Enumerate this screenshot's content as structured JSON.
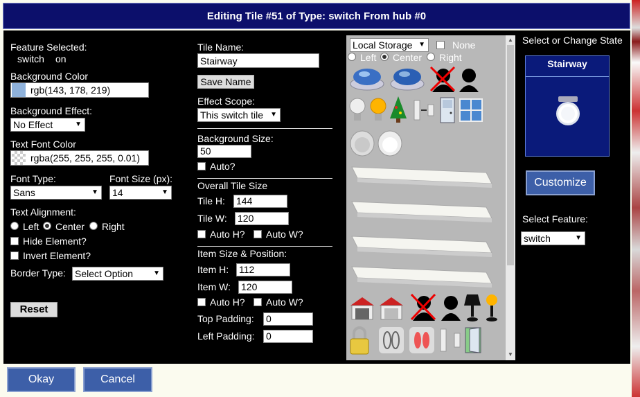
{
  "title": "Editing Tile #51 of Type: switch From hub #0",
  "left": {
    "feature_label": "Feature Selected:",
    "feature_name": "switch",
    "feature_state": "on",
    "bg_color_label": "Background Color",
    "bg_color_value": "rgb(143, 178, 219)",
    "bg_color_swatch": "#8fb2db",
    "bg_effect_label": "Background Effect:",
    "bg_effect_value": "No Effect",
    "text_color_label": "Text Font Color",
    "text_color_value": "rgba(255, 255, 255, 0.01)",
    "font_type_label": "Font Type:",
    "font_type_value": "Sans",
    "font_size_label": "Font Size (px):",
    "font_size_value": "14",
    "align_label": "Text Alignment:",
    "align_left": "Left",
    "align_center": "Center",
    "align_right": "Right",
    "hide_label": "Hide Element?",
    "invert_label": "Invert Element?",
    "border_label": "Border Type:",
    "border_value": "Select Option",
    "reset_label": "Reset"
  },
  "middle": {
    "tile_name_label": "Tile Name:",
    "tile_name_value": "Stairway",
    "save_name_label": "Save Name",
    "effect_scope_label": "Effect Scope:",
    "effect_scope_value": "This switch tile",
    "bg_size_label": "Background Size:",
    "bg_size_value": "50",
    "auto_label": "Auto?",
    "overall_label": "Overall Tile Size",
    "tile_h_label": "Tile H:",
    "tile_h_value": "144",
    "tile_w_label": "Tile W:",
    "tile_w_value": "120",
    "auto_h_label": "Auto H?",
    "auto_w_label": "Auto W?",
    "item_label": "Item Size & Position:",
    "item_h_label": "Item H:",
    "item_h_value": "112",
    "item_w_label": "Item W:",
    "item_w_value": "120",
    "item_auto_h_label": "Auto H?",
    "item_auto_w_label": "Auto W?",
    "top_pad_label": "Top Padding:",
    "top_pad_value": "0",
    "left_pad_label": "Left Padding:",
    "left_pad_value": "0"
  },
  "gallery": {
    "storage_value": "Local Storage",
    "none_label": "None",
    "pos_left": "Left",
    "pos_center": "Center",
    "pos_right": "Right"
  },
  "right": {
    "state_label": "Select or Change State",
    "tile_name": "Stairway",
    "customize_label": "Customize",
    "select_feature_label": "Select Feature:",
    "select_feature_value": "switch"
  },
  "footer": {
    "ok_label": "Okay",
    "cancel_label": "Cancel"
  }
}
